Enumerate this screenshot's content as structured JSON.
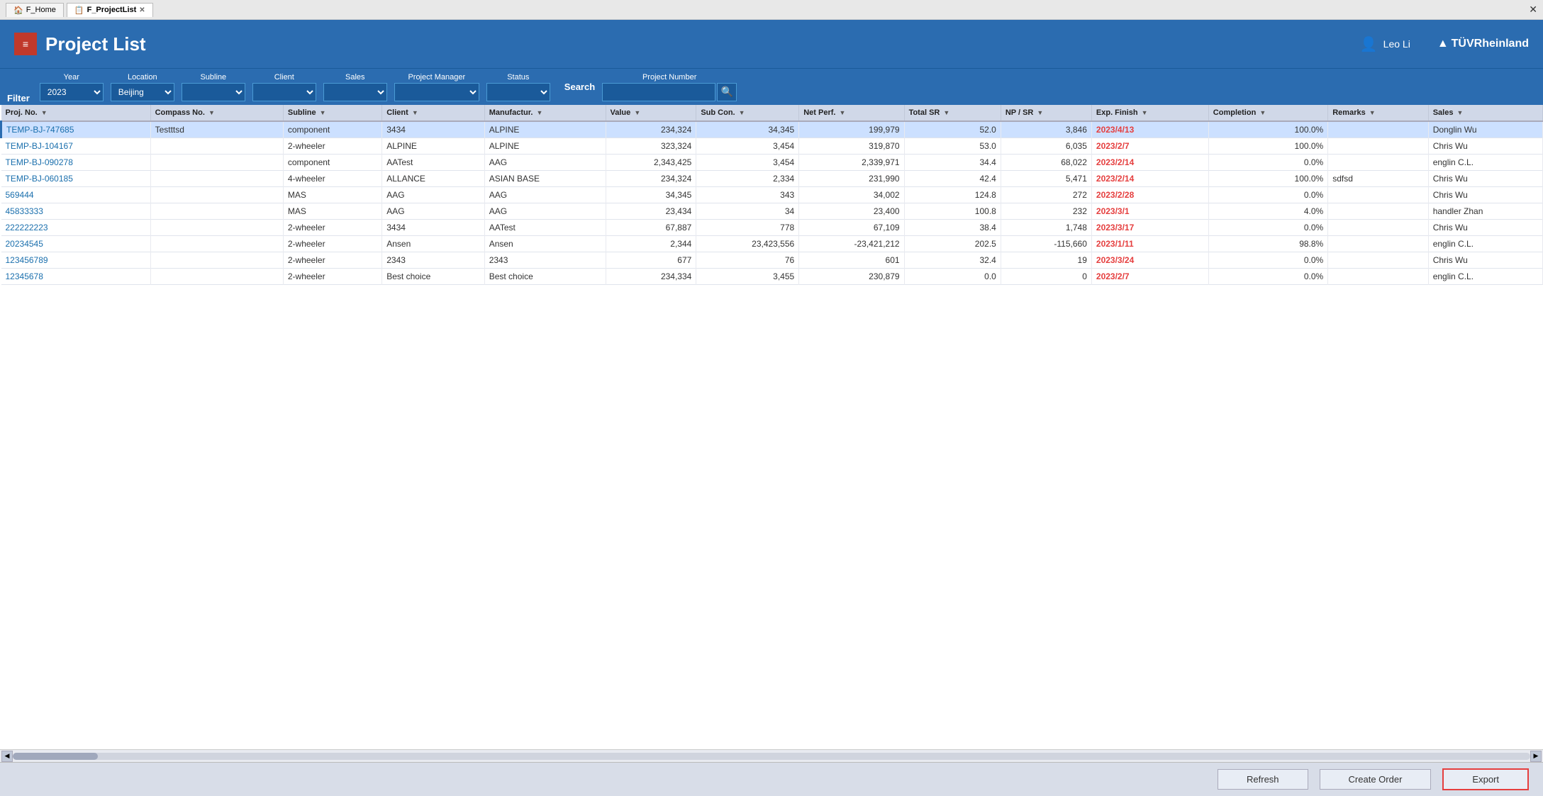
{
  "titleBar": {
    "tabs": [
      {
        "id": "home",
        "label": "F_Home",
        "icon": "🏠",
        "active": false
      },
      {
        "id": "projectlist",
        "label": "F_ProjectList",
        "icon": "📋",
        "active": true
      }
    ],
    "closeLabel": "✕"
  },
  "header": {
    "logoText": "≡",
    "title": "Project List",
    "user": {
      "name": "Leo Li",
      "icon": "👤"
    },
    "brand": "TÜVRheinland"
  },
  "filterBar": {
    "filterLabel": "Filter",
    "searchLabel": "Search",
    "searchPlaceholder": "",
    "searchIcon": "🔍",
    "fields": [
      {
        "id": "year",
        "label": "Year",
        "value": "2023"
      },
      {
        "id": "location",
        "label": "Location",
        "value": "Beijing"
      },
      {
        "id": "subline",
        "label": "Subline",
        "value": ""
      },
      {
        "id": "client",
        "label": "Client",
        "value": ""
      },
      {
        "id": "sales",
        "label": "Sales",
        "value": ""
      },
      {
        "id": "projectManager",
        "label": "Project Manager",
        "value": ""
      },
      {
        "id": "status",
        "label": "Status",
        "value": ""
      }
    ]
  },
  "table": {
    "columns": [
      {
        "id": "projNo",
        "label": "Proj. No.",
        "sortable": true
      },
      {
        "id": "compassNo",
        "label": "Compass No.",
        "sortable": true
      },
      {
        "id": "subline",
        "label": "Subline",
        "sortable": true
      },
      {
        "id": "client",
        "label": "Client",
        "sortable": true
      },
      {
        "id": "manufacturer",
        "label": "Manufactur.",
        "sortable": true
      },
      {
        "id": "value",
        "label": "Value",
        "sortable": true
      },
      {
        "id": "subCon",
        "label": "Sub Con.",
        "sortable": true
      },
      {
        "id": "netPerf",
        "label": "Net Perf.",
        "sortable": true
      },
      {
        "id": "totalSR",
        "label": "Total SR",
        "sortable": true
      },
      {
        "id": "npSR",
        "label": "NP / SR",
        "sortable": true
      },
      {
        "id": "expFinish",
        "label": "Exp. Finish",
        "sortable": true
      },
      {
        "id": "completion",
        "label": "Completion",
        "sortable": true
      },
      {
        "id": "remarks",
        "label": "Remarks",
        "sortable": true
      },
      {
        "id": "sales",
        "label": "Sales",
        "sortable": true
      }
    ],
    "rows": [
      {
        "projNo": "TEMP-BJ-747685",
        "compassNo": "Testttsd",
        "subline": "component",
        "client": "3434",
        "manufacturer": "ALPINE",
        "value": "234,324",
        "subCon": "34,345",
        "netPerf": "199,979",
        "totalSR": "52.0",
        "npSR": "3,846",
        "expFinish": "2023/4/13",
        "expFinishRed": true,
        "completion": "100.0%",
        "remarks": "",
        "sales": "Donglin Wu",
        "selected": true
      },
      {
        "projNo": "TEMP-BJ-104167",
        "compassNo": "",
        "subline": "2-wheeler",
        "client": "ALPINE",
        "manufacturer": "ALPINE",
        "value": "323,324",
        "subCon": "3,454",
        "netPerf": "319,870",
        "totalSR": "53.0",
        "npSR": "6,035",
        "expFinish": "2023/2/7",
        "expFinishRed": true,
        "completion": "100.0%",
        "remarks": "",
        "sales": "Chris Wu",
        "selected": false
      },
      {
        "projNo": "TEMP-BJ-090278",
        "compassNo": "",
        "subline": "component",
        "client": "AATest",
        "manufacturer": "AAG",
        "value": "2,343,425",
        "subCon": "3,454",
        "netPerf": "2,339,971",
        "totalSR": "34.4",
        "npSR": "68,022",
        "expFinish": "2023/2/14",
        "expFinishRed": true,
        "completion": "0.0%",
        "remarks": "",
        "sales": "englin C.L.",
        "selected": false
      },
      {
        "projNo": "TEMP-BJ-060185",
        "compassNo": "",
        "subline": "4-wheeler",
        "client": "ALLANCE",
        "manufacturer": "ASIAN BASE",
        "value": "234,324",
        "subCon": "2,334",
        "netPerf": "231,990",
        "totalSR": "42.4",
        "npSR": "5,471",
        "expFinish": "2023/2/14",
        "expFinishRed": true,
        "completion": "100.0%",
        "remarks": "sdfsd",
        "sales": "Chris Wu",
        "selected": false
      },
      {
        "projNo": "569444",
        "compassNo": "",
        "subline": "MAS",
        "client": "AAG",
        "manufacturer": "AAG",
        "value": "34,345",
        "subCon": "343",
        "netPerf": "34,002",
        "totalSR": "124.8",
        "npSR": "272",
        "expFinish": "2023/2/28",
        "expFinishRed": true,
        "completion": "0.0%",
        "remarks": "",
        "sales": "Chris Wu",
        "selected": false
      },
      {
        "projNo": "45833333",
        "compassNo": "",
        "subline": "MAS",
        "client": "AAG",
        "manufacturer": "AAG",
        "value": "23,434",
        "subCon": "34",
        "netPerf": "23,400",
        "totalSR": "100.8",
        "npSR": "232",
        "expFinish": "2023/3/1",
        "expFinishRed": true,
        "completion": "4.0%",
        "remarks": "",
        "sales": "handler Zhan",
        "selected": false
      },
      {
        "projNo": "222222223",
        "compassNo": "",
        "subline": "2-wheeler",
        "client": "3434",
        "manufacturer": "AATest",
        "value": "67,887",
        "subCon": "778",
        "netPerf": "67,109",
        "totalSR": "38.4",
        "npSR": "1,748",
        "expFinish": "2023/3/17",
        "expFinishRed": true,
        "completion": "0.0%",
        "remarks": "",
        "sales": "Chris Wu",
        "selected": false
      },
      {
        "projNo": "20234545",
        "compassNo": "",
        "subline": "2-wheeler",
        "client": "Ansen",
        "manufacturer": "Ansen",
        "value": "2,344",
        "subCon": "23,423,556",
        "netPerf": "-23,421,212",
        "totalSR": "202.5",
        "npSR": "-115,660",
        "expFinish": "2023/1/11",
        "expFinishRed": true,
        "completion": "98.8%",
        "remarks": "",
        "sales": "englin C.L.",
        "selected": false
      },
      {
        "projNo": "123456789",
        "compassNo": "",
        "subline": "2-wheeler",
        "client": "2343",
        "manufacturer": "2343",
        "value": "677",
        "subCon": "76",
        "netPerf": "601",
        "totalSR": "32.4",
        "npSR": "19",
        "expFinish": "2023/3/24",
        "expFinishRed": true,
        "completion": "0.0%",
        "remarks": "",
        "sales": "Chris Wu",
        "selected": false
      },
      {
        "projNo": "12345678",
        "compassNo": "",
        "subline": "2-wheeler",
        "client": "Best choice",
        "manufacturer": "Best choice",
        "value": "234,334",
        "subCon": "3,455",
        "netPerf": "230,879",
        "totalSR": "0.0",
        "npSR": "0",
        "expFinish": "2023/2/7",
        "expFinishRed": true,
        "completion": "0.0%",
        "remarks": "",
        "sales": "englin C.L.",
        "selected": false
      }
    ]
  },
  "footer": {
    "refreshLabel": "Refresh",
    "createOrderLabel": "Create Order",
    "exportLabel": "Export"
  }
}
